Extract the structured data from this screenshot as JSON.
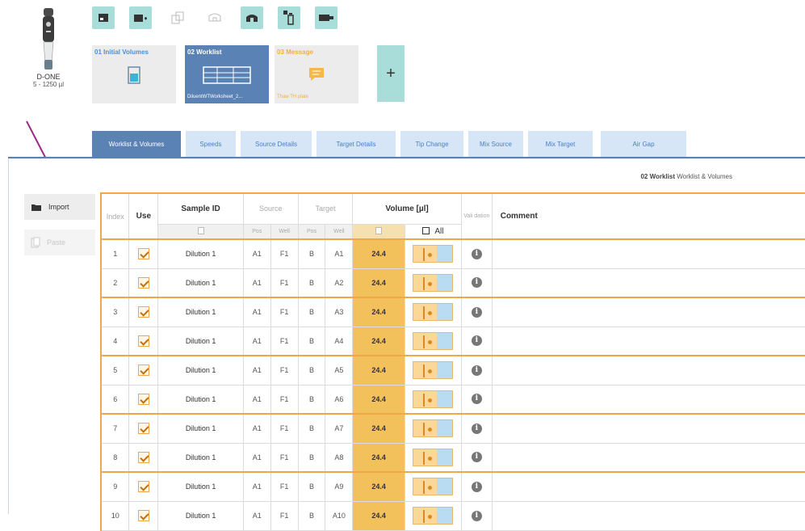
{
  "device": {
    "name": "D-ONE",
    "range": "5 - 1250 µl",
    "icon": "pipette-icon"
  },
  "toolbar": {
    "buttons": [
      {
        "icon": "initial-volume-icon",
        "enabled": true
      },
      {
        "icon": "add-tube-icon",
        "enabled": true
      },
      {
        "icon": "copy-step-icon",
        "enabled": false
      },
      {
        "icon": "tip-icon",
        "enabled": false
      },
      {
        "icon": "rotate-tip-icon",
        "enabled": true
      },
      {
        "icon": "eject-tip-icon",
        "enabled": true
      },
      {
        "icon": "module-icon",
        "enabled": true
      }
    ]
  },
  "steps": [
    {
      "title": "01 Initial Volumes",
      "subtitle": ""
    },
    {
      "title": "02 Worklist",
      "subtitle": "DiluentWTWorksheet_2..."
    },
    {
      "title": "03 Message",
      "subtitle": "Thaw TH plate"
    }
  ],
  "add_step_label": "+",
  "tabs": [
    "Worklist & Volumes",
    "Speeds",
    "Source Details",
    "Target Details",
    "Tip Change",
    "Mix Source",
    "Mix Target",
    "Air Gap"
  ],
  "panel_title": {
    "bold": "02 Worklist",
    "rest": "Worklist & Volumes"
  },
  "sidebar": {
    "import_label": "Import",
    "paste_label": "Paste"
  },
  "table": {
    "headers": {
      "index": "Index",
      "use": "Use",
      "sample_id": "Sample ID",
      "source": "Source",
      "target": "Target",
      "volume": "Volume [µl]",
      "validation": "Vali dation",
      "comment": "Comment"
    },
    "subheaders": {
      "pos": "Pos",
      "well": "Well",
      "all": "All"
    },
    "rows": [
      {
        "index": "1",
        "sample": "Dilution 1",
        "src_pos": "A1",
        "src_well": "F1",
        "tgt_pos": "B",
        "tgt_well": "A1",
        "volume": "24.4"
      },
      {
        "index": "2",
        "sample": "Dilution 1",
        "src_pos": "A1",
        "src_well": "F1",
        "tgt_pos": "B",
        "tgt_well": "A2",
        "volume": "24.4"
      },
      {
        "index": "3",
        "sample": "Dilution 1",
        "src_pos": "A1",
        "src_well": "F1",
        "tgt_pos": "B",
        "tgt_well": "A3",
        "volume": "24.4"
      },
      {
        "index": "4",
        "sample": "Dilution 1",
        "src_pos": "A1",
        "src_well": "F1",
        "tgt_pos": "B",
        "tgt_well": "A4",
        "volume": "24.4"
      },
      {
        "index": "5",
        "sample": "Dilution 1",
        "src_pos": "A1",
        "src_well": "F1",
        "tgt_pos": "B",
        "tgt_well": "A5",
        "volume": "24.4"
      },
      {
        "index": "6",
        "sample": "Dilution 1",
        "src_pos": "A1",
        "src_well": "F1",
        "tgt_pos": "B",
        "tgt_well": "A6",
        "volume": "24.4"
      },
      {
        "index": "7",
        "sample": "Dilution 1",
        "src_pos": "A1",
        "src_well": "F1",
        "tgt_pos": "B",
        "tgt_well": "A7",
        "volume": "24.4"
      },
      {
        "index": "8",
        "sample": "Dilution 1",
        "src_pos": "A1",
        "src_well": "F1",
        "tgt_pos": "B",
        "tgt_well": "A8",
        "volume": "24.4"
      },
      {
        "index": "9",
        "sample": "Dilution 1",
        "src_pos": "A1",
        "src_well": "F1",
        "tgt_pos": "B",
        "tgt_well": "A9",
        "volume": "24.4"
      },
      {
        "index": "10",
        "sample": "Dilution 1",
        "src_pos": "A1",
        "src_well": "F1",
        "tgt_pos": "B",
        "tgt_well": "A10",
        "volume": "24.4"
      }
    ]
  },
  "colors": {
    "accent": "#5b82b5",
    "teal": "#a9ddda",
    "orange": "#f0a848",
    "volume": "#f3c15c",
    "arrow": "#9b2c8a"
  }
}
